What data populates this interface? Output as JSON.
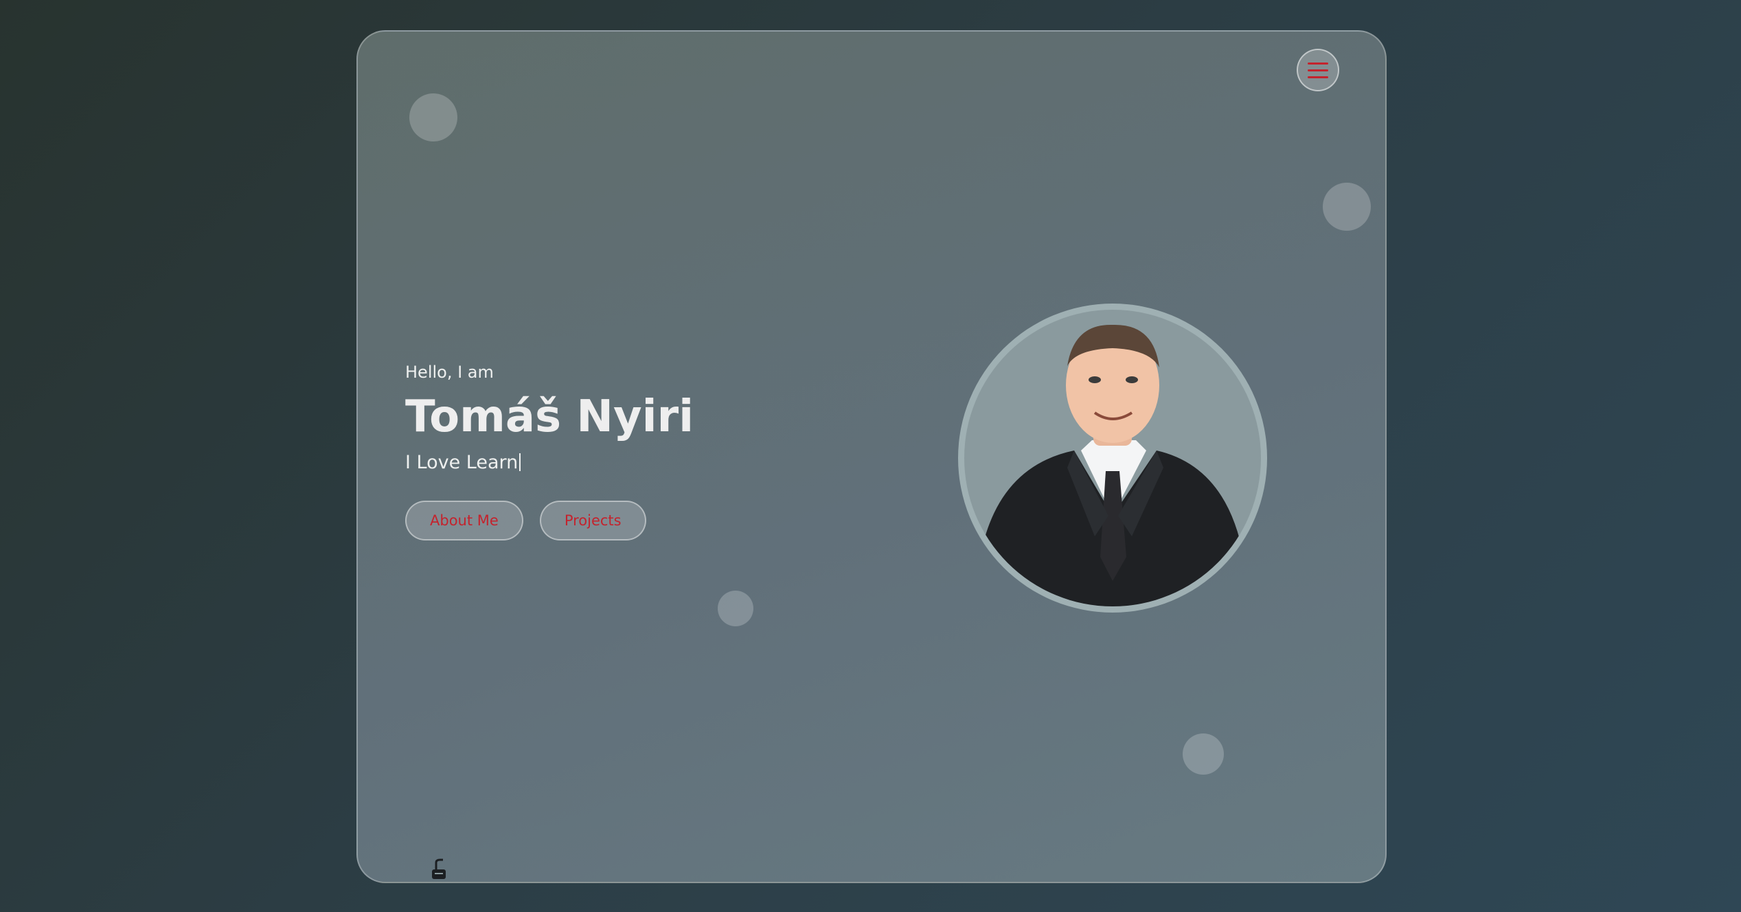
{
  "hero": {
    "greeting": "Hello, I am",
    "name": "Tomáš Nyiri",
    "tagline": "I Love Learn"
  },
  "buttons": {
    "about": "About Me",
    "projects": "Projects"
  },
  "icons": {
    "menu": "hamburger-menu-icon",
    "footer": "scroll-indicator-icon"
  },
  "colors": {
    "accent": "#c4232d",
    "card": "#616f76",
    "background": "#2c3d44"
  }
}
